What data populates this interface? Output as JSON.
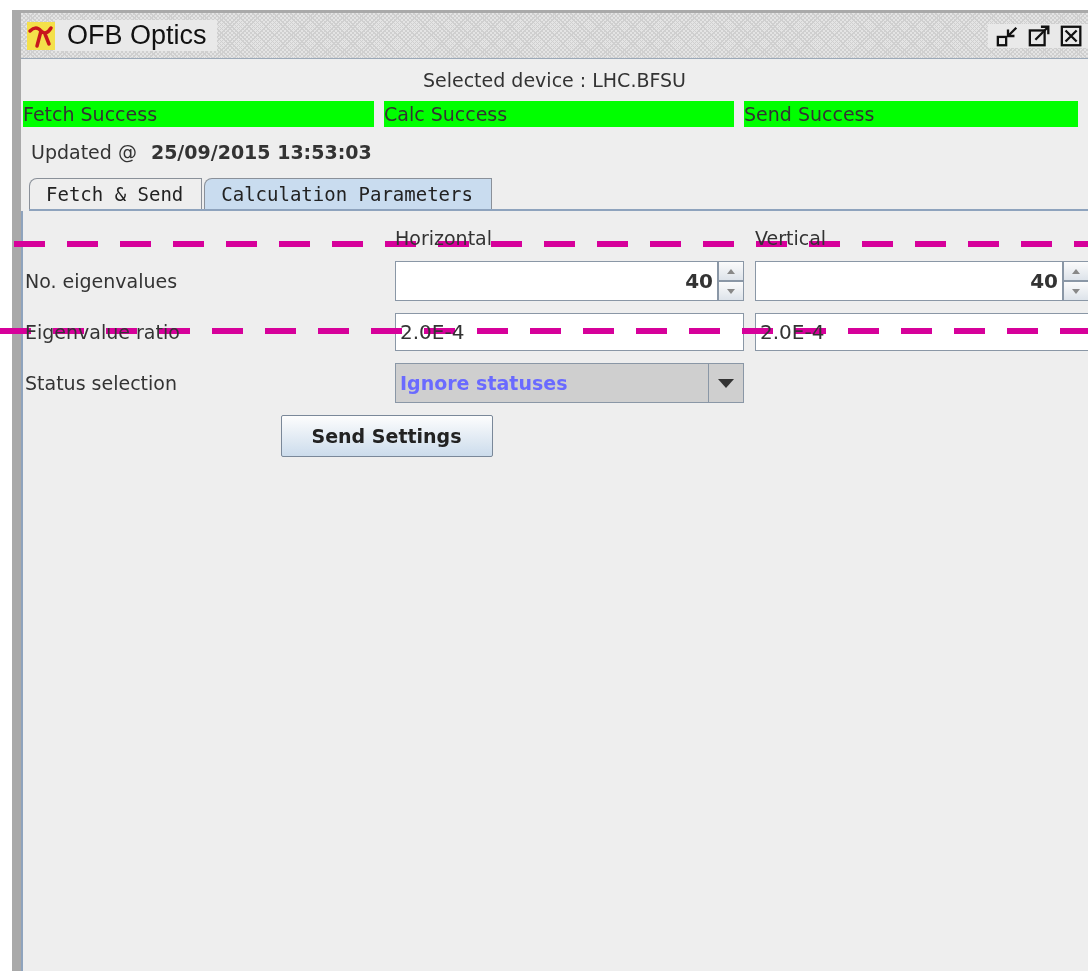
{
  "window": {
    "title": "OFB Optics"
  },
  "selected_device": "Selected device : LHC.BFSU",
  "status_indicators": [
    {
      "label": "Fetch Success",
      "color": "#00ff00"
    },
    {
      "label": "Calc Success",
      "color": "#00ff00"
    },
    {
      "label": "Send Success",
      "color": "#00ff00"
    }
  ],
  "updated": {
    "label": "Updated @",
    "timestamp": "25/09/2015 13:53:03"
  },
  "tabs": [
    {
      "label": "Fetch & Send",
      "selected": false
    },
    {
      "label": "Calculation Parameters",
      "selected": true
    }
  ],
  "form": {
    "columns": [
      "Horizontal",
      "Vertical"
    ],
    "rows": [
      {
        "kind": "spinner",
        "label": "No. eigenvalues",
        "values": [
          "40",
          "40"
        ]
      },
      {
        "kind": "text",
        "label": "Eigenvalue ratio",
        "values": [
          "2.0E-4",
          "2.0E-4"
        ]
      },
      {
        "kind": "dropdown",
        "label": "Status selection",
        "values": [
          "Ignore statuses"
        ]
      }
    ]
  },
  "buttons": [
    "Send Settings"
  ],
  "annotations": [
    {
      "kind": "dashed-line"
    },
    {
      "kind": "dashed-line"
    }
  ]
}
